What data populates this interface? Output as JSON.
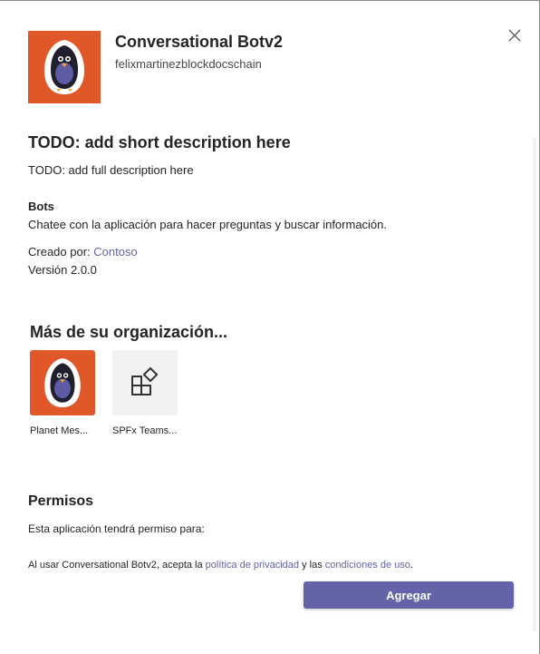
{
  "app": {
    "title": "Conversational Botv2",
    "publisher": "felixmartinezblockdocschain",
    "short_description": "TODO: add short description here",
    "full_description": "TODO: add full description here"
  },
  "bots": {
    "heading": "Bots",
    "description": "Chatee con la aplicación para hacer preguntas y buscar información."
  },
  "details": {
    "created_by_label": "Creado por: ",
    "created_by_link": "Contoso",
    "version": "Versión 2.0.0"
  },
  "more": {
    "heading": "Más de su organización...",
    "apps": [
      {
        "label": "Planet Mes...",
        "icon": "penguin-logo-icon"
      },
      {
        "label": "SPFx Teams...",
        "icon": "apps-icon"
      }
    ]
  },
  "permissions": {
    "heading": "Permisos",
    "description": "Esta aplicación tendrá permiso para:",
    "legal_prefix": "Al usar Conversational Botv2, acepta la ",
    "privacy_link": "política de privacidad",
    "legal_middle": " y las ",
    "terms_link": "condiciones de uso",
    "legal_suffix": "."
  },
  "actions": {
    "add_label": "Agregar",
    "close_icon": "close-icon"
  },
  "colors": {
    "accent": "#6264a7",
    "logo_bg": "#e0572a",
    "text": "#252423"
  }
}
